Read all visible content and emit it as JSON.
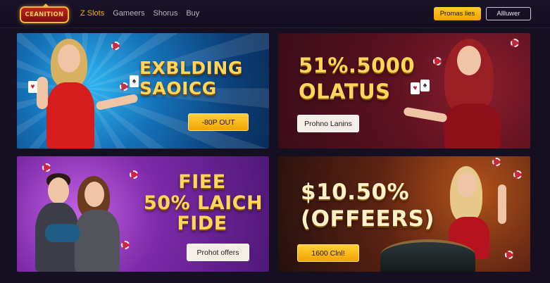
{
  "header": {
    "logo_text": "CEANITION",
    "nav": [
      "Z Slots",
      "Gameers",
      "Shorus",
      "Buy"
    ],
    "promo_button": "Promas lies",
    "all_button": "Allluwer"
  },
  "cards": [
    {
      "headline": [
        "EXBLDING",
        "SAOICG"
      ],
      "cta": "-80P OUT",
      "theme": "#0c3f78"
    },
    {
      "headline": [
        "51%.5000",
        "OLATUS"
      ],
      "cta": "Prohno Lanins",
      "theme": "#5a1120"
    },
    {
      "headline": [
        "FIEE",
        "50% LAICH",
        "FIDE"
      ],
      "cta": "Prohot offers",
      "theme": "#7d2aa9"
    },
    {
      "headline": [
        "$10.50%",
        "(OFFEERS)"
      ],
      "cta": "1600 Clnl!",
      "theme": "#5e2312"
    }
  ],
  "colors": {
    "accent": "#f0b129",
    "background": "#150f22"
  }
}
